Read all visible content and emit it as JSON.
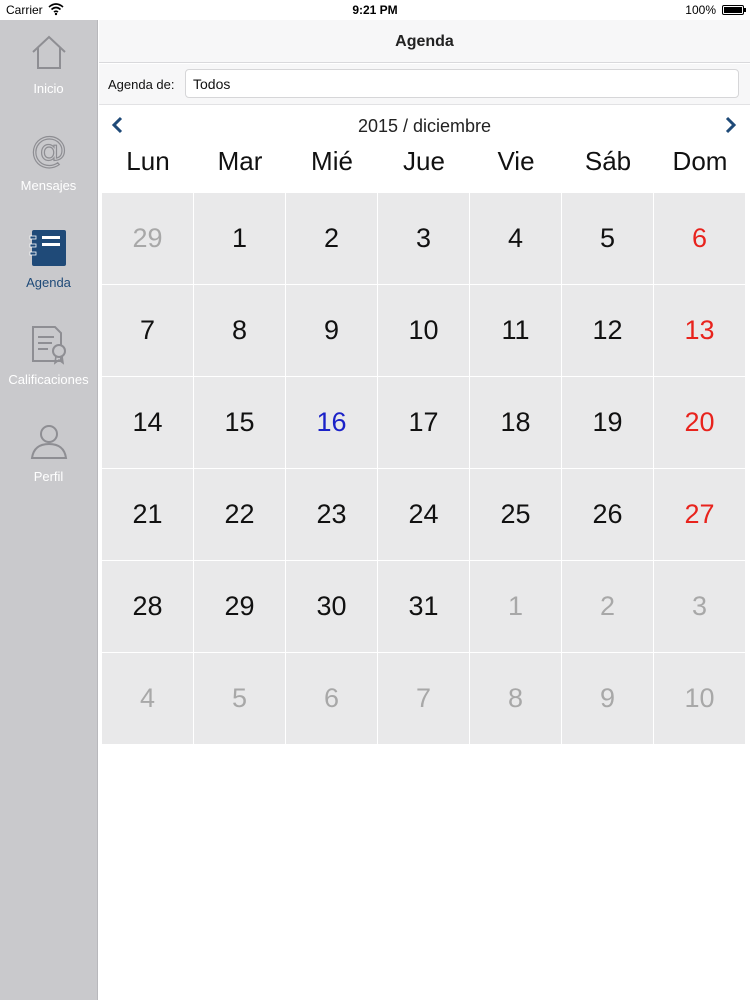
{
  "status": {
    "carrier": "Carrier",
    "time": "9:21 PM",
    "battery": "100%"
  },
  "sidebar": {
    "tabs": [
      {
        "label": "Inicio",
        "icon": "home-icon",
        "active": false
      },
      {
        "label": "Mensajes",
        "icon": "at-sign-icon",
        "active": false
      },
      {
        "label": "Agenda",
        "icon": "agenda-notebook-icon",
        "active": true
      },
      {
        "label": "Calificaciones",
        "icon": "certificate-icon",
        "active": false
      },
      {
        "label": "Perfil",
        "icon": "person-icon",
        "active": false
      }
    ]
  },
  "header": {
    "title": "Agenda"
  },
  "filter": {
    "label": "Agenda de:",
    "value": "Todos"
  },
  "calendar": {
    "month_title": "2015 / diciembre",
    "weekdays": [
      "Lun",
      "Mar",
      "Mié",
      "Jue",
      "Vie",
      "Sáb",
      "Dom"
    ],
    "weeks": [
      [
        {
          "d": "29",
          "t": "other"
        },
        {
          "d": "1",
          "t": "normal"
        },
        {
          "d": "2",
          "t": "normal"
        },
        {
          "d": "3",
          "t": "normal"
        },
        {
          "d": "4",
          "t": "normal"
        },
        {
          "d": "5",
          "t": "normal"
        },
        {
          "d": "6",
          "t": "sunday"
        }
      ],
      [
        {
          "d": "7",
          "t": "normal"
        },
        {
          "d": "8",
          "t": "normal"
        },
        {
          "d": "9",
          "t": "normal"
        },
        {
          "d": "10",
          "t": "normal"
        },
        {
          "d": "11",
          "t": "normal"
        },
        {
          "d": "12",
          "t": "normal"
        },
        {
          "d": "13",
          "t": "sunday"
        }
      ],
      [
        {
          "d": "14",
          "t": "normal"
        },
        {
          "d": "15",
          "t": "normal"
        },
        {
          "d": "16",
          "t": "today"
        },
        {
          "d": "17",
          "t": "normal"
        },
        {
          "d": "18",
          "t": "normal"
        },
        {
          "d": "19",
          "t": "normal"
        },
        {
          "d": "20",
          "t": "sunday"
        }
      ],
      [
        {
          "d": "21",
          "t": "normal"
        },
        {
          "d": "22",
          "t": "normal"
        },
        {
          "d": "23",
          "t": "normal"
        },
        {
          "d": "24",
          "t": "normal"
        },
        {
          "d": "25",
          "t": "normal"
        },
        {
          "d": "26",
          "t": "normal"
        },
        {
          "d": "27",
          "t": "sunday"
        }
      ],
      [
        {
          "d": "28",
          "t": "normal"
        },
        {
          "d": "29",
          "t": "normal"
        },
        {
          "d": "30",
          "t": "normal"
        },
        {
          "d": "31",
          "t": "normal"
        },
        {
          "d": "1",
          "t": "other"
        },
        {
          "d": "2",
          "t": "other"
        },
        {
          "d": "3",
          "t": "other"
        }
      ],
      [
        {
          "d": "4",
          "t": "other"
        },
        {
          "d": "5",
          "t": "other"
        },
        {
          "d": "6",
          "t": "other"
        },
        {
          "d": "7",
          "t": "other"
        },
        {
          "d": "8",
          "t": "other"
        },
        {
          "d": "9",
          "t": "other"
        },
        {
          "d": "10",
          "t": "other"
        }
      ]
    ]
  },
  "colors": {
    "sidebar_bg": "#c9c9cc",
    "active_tab": "#1f4a78",
    "sunday": "#e8231d",
    "today": "#1b22c8",
    "other_month": "#a8a8a8",
    "cell_bg": "#e9e9ea"
  }
}
